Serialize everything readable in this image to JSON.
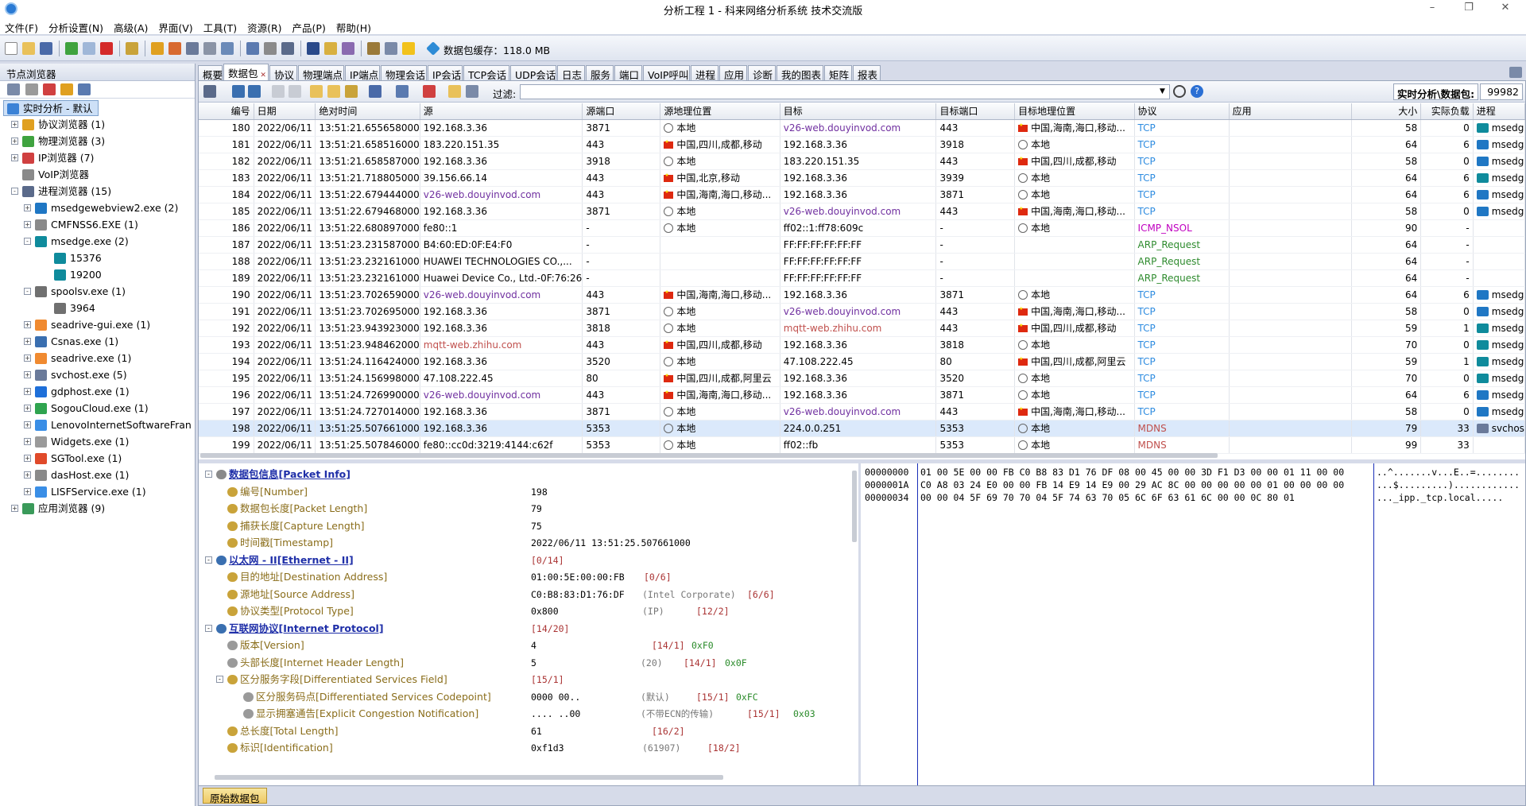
{
  "window": {
    "title": "分析工程 1 - 科来网络分析系统 技术交流版"
  },
  "menu": [
    "文件(F)",
    "分析设置(N)",
    "高级(A)",
    "界面(V)",
    "工具(T)",
    "资源(R)",
    "产品(P)",
    "帮助(H)"
  ],
  "toolbar": {
    "cache_label": "数据包缓存：118.0 MB"
  },
  "left_panel": {
    "title": "节点浏览器",
    "tree": [
      {
        "label": "实时分析 - 默认",
        "level": 0,
        "exp": "",
        "icon": "analysis-icon",
        "color": "#3b82d6",
        "selected": true
      },
      {
        "label": "协议浏览器 (1)",
        "level": 1,
        "exp": "+",
        "icon": "protocol-icon",
        "color": "#e0a020"
      },
      {
        "label": "物理浏览器 (3)",
        "level": 1,
        "exp": "+",
        "icon": "physical-icon",
        "color": "#3fa33f"
      },
      {
        "label": "IP浏览器 (7)",
        "level": 1,
        "exp": "+",
        "icon": "ip-icon",
        "color": "#d04040"
      },
      {
        "label": "VoIP浏览器",
        "level": 1,
        "exp": "",
        "icon": "voip-icon",
        "color": "#8a8a8a"
      },
      {
        "label": "进程浏览器 (15)",
        "level": 1,
        "exp": "-",
        "icon": "process-icon",
        "color": "#5a6a8a"
      },
      {
        "label": "msedgewebview2.exe (2)",
        "level": 2,
        "exp": "+",
        "icon": "webview-icon",
        "color": "#1f77c4"
      },
      {
        "label": "CMFNSS6.EXE (1)",
        "level": 2,
        "exp": "+",
        "icon": "app-icon",
        "color": "#8a8a8a"
      },
      {
        "label": "msedge.exe (2)",
        "level": 2,
        "exp": "-",
        "icon": "edge-icon",
        "color": "#0f8b9c"
      },
      {
        "label": "15376",
        "level": 3,
        "exp": "",
        "icon": "edge-icon",
        "color": "#0f8b9c"
      },
      {
        "label": "19200",
        "level": 3,
        "exp": "",
        "icon": "edge-icon",
        "color": "#0f8b9c"
      },
      {
        "label": "spoolsv.exe (1)",
        "level": 2,
        "exp": "-",
        "icon": "printer-icon",
        "color": "#707070"
      },
      {
        "label": "3964",
        "level": 3,
        "exp": "",
        "icon": "printer-icon",
        "color": "#707070"
      },
      {
        "label": "seadrive-gui.exe (1)",
        "level": 2,
        "exp": "+",
        "icon": "seadrive-icon",
        "color": "#f08a30"
      },
      {
        "label": "Csnas.exe (1)",
        "level": 2,
        "exp": "+",
        "icon": "csnas-icon",
        "color": "#3a6fb0"
      },
      {
        "label": "seadrive.exe (1)",
        "level": 2,
        "exp": "+",
        "icon": "seadrive-icon",
        "color": "#f08a30"
      },
      {
        "label": "svchost.exe (5)",
        "level": 2,
        "exp": "+",
        "icon": "svchost-icon",
        "color": "#6a7a9a"
      },
      {
        "label": "gdphost.exe (1)",
        "level": 2,
        "exp": "+",
        "icon": "gdp-icon",
        "color": "#1e6fd9"
      },
      {
        "label": "SogouCloud.exe (1)",
        "level": 2,
        "exp": "+",
        "icon": "sogou-icon",
        "color": "#2fa44f"
      },
      {
        "label": "LenovoInternetSoftwareFran",
        "level": 2,
        "exp": "+",
        "icon": "lenovo-icon",
        "color": "#3a8ee6"
      },
      {
        "label": "Widgets.exe (1)",
        "level": 2,
        "exp": "+",
        "icon": "widgets-icon",
        "color": "#9a9a9a"
      },
      {
        "label": "SGTool.exe (1)",
        "level": 2,
        "exp": "+",
        "icon": "sgtool-icon",
        "color": "#e04a2a"
      },
      {
        "label": "dasHost.exe (1)",
        "level": 2,
        "exp": "+",
        "icon": "app-icon",
        "color": "#8a8a8a"
      },
      {
        "label": "LISFService.exe (1)",
        "level": 2,
        "exp": "+",
        "icon": "lisf-icon",
        "color": "#3a8ee6"
      },
      {
        "label": "应用浏览器 (9)",
        "level": 1,
        "exp": "+",
        "icon": "application-icon",
        "color": "#3a9a5a"
      }
    ]
  },
  "tabs": [
    "概要",
    "数据包",
    "协议",
    "物理端点",
    "IP端点",
    "物理会话",
    "IP会话",
    "TCP会话",
    "UDP会话",
    "日志",
    "服务",
    "端口",
    "VoIP呼叫",
    "进程",
    "应用",
    "诊断",
    "我的图表",
    "矩阵",
    "报表"
  ],
  "active_tab": 1,
  "filter": {
    "label": "过滤:",
    "value": ""
  },
  "realtime": {
    "label": "实时分析\\数据包:",
    "value": "99982"
  },
  "columns": [
    "编号",
    "日期",
    "绝对时间",
    "源",
    "源端口",
    "源地理位置",
    "目标",
    "目标端口",
    "目标地理位置",
    "协议",
    "应用",
    "大小",
    "实际负载",
    "进程"
  ],
  "packets": [
    {
      "no": "180",
      "date": "2022/06/11",
      "time": "13:51:21.655658000",
      "src": "192.168.3.36",
      "sport": "3871",
      "sgeo": "本地",
      "sflag": "globe",
      "dst": "v26-web.douyinvod.com",
      "dport": "443",
      "dgeo": "中国,海南,海口,移动...",
      "dflag": "cn",
      "proto": "TCP",
      "app": "",
      "size": "58",
      "payload": "0",
      "proc": "msedg",
      "pic": "#0f8b9c"
    },
    {
      "no": "181",
      "date": "2022/06/11",
      "time": "13:51:21.658516000",
      "src": "183.220.151.35",
      "sport": "443",
      "sgeo": "中国,四川,成都,移动",
      "sflag": "cn",
      "dst": "192.168.3.36",
      "dport": "3918",
      "dgeo": "本地",
      "dflag": "globe",
      "proto": "TCP",
      "app": "",
      "size": "64",
      "payload": "6",
      "proc": "msedg",
      "pic": "#1f77c4"
    },
    {
      "no": "182",
      "date": "2022/06/11",
      "time": "13:51:21.658587000",
      "src": "192.168.3.36",
      "sport": "3918",
      "sgeo": "本地",
      "sflag": "globe",
      "dst": "183.220.151.35",
      "dport": "443",
      "dgeo": "中国,四川,成都,移动",
      "dflag": "cn",
      "proto": "TCP",
      "app": "",
      "size": "58",
      "payload": "0",
      "proc": "msedg",
      "pic": "#1f77c4"
    },
    {
      "no": "183",
      "date": "2022/06/11",
      "time": "13:51:21.718805000",
      "src": "39.156.66.14",
      "sport": "443",
      "sgeo": "中国,北京,移动",
      "sflag": "cn",
      "dst": "192.168.3.36",
      "dport": "3939",
      "dgeo": "本地",
      "dflag": "globe",
      "proto": "TCP",
      "app": "",
      "size": "64",
      "payload": "6",
      "proc": "msedg",
      "pic": "#0f8b9c"
    },
    {
      "no": "184",
      "date": "2022/06/11",
      "time": "13:51:22.679444000",
      "src": "v26-web.douyinvod.com",
      "sport": "443",
      "sgeo": "中国,海南,海口,移动...",
      "sflag": "cn",
      "dst": "192.168.3.36",
      "dport": "3871",
      "dgeo": "本地",
      "dflag": "globe",
      "proto": "TCP",
      "app": "",
      "size": "64",
      "payload": "6",
      "proc": "msedg",
      "pic": "#1f77c4"
    },
    {
      "no": "185",
      "date": "2022/06/11",
      "time": "13:51:22.679468000",
      "src": "192.168.3.36",
      "sport": "3871",
      "sgeo": "本地",
      "sflag": "globe",
      "dst": "v26-web.douyinvod.com",
      "dport": "443",
      "dgeo": "中国,海南,海口,移动...",
      "dflag": "cn",
      "proto": "TCP",
      "app": "",
      "size": "58",
      "payload": "0",
      "proc": "msedg",
      "pic": "#1f77c4"
    },
    {
      "no": "186",
      "date": "2022/06/11",
      "time": "13:51:22.680897000",
      "src": "fe80::1",
      "sport": "-",
      "sgeo": "本地",
      "sflag": "globe",
      "dst": "ff02::1:ff78:609c",
      "dport": "-",
      "dgeo": "本地",
      "dflag": "globe",
      "proto": "ICMP_NSOL",
      "app": "",
      "size": "90",
      "payload": "-",
      "proc": "",
      "pic": ""
    },
    {
      "no": "187",
      "date": "2022/06/11",
      "time": "13:51:23.231587000",
      "src": "B4:60:ED:0F:E4:F0",
      "sport": "-",
      "sgeo": "",
      "sflag": "",
      "dst": "FF:FF:FF:FF:FF:FF",
      "dport": "-",
      "dgeo": "",
      "dflag": "",
      "proto": "ARP_Request",
      "app": "",
      "size": "64",
      "payload": "-",
      "proc": "",
      "pic": ""
    },
    {
      "no": "188",
      "date": "2022/06/11",
      "time": "13:51:23.232161000",
      "src": "HUAWEI TECHNOLOGIES CO.,...",
      "sport": "-",
      "sgeo": "",
      "sflag": "",
      "dst": "FF:FF:FF:FF:FF:FF",
      "dport": "-",
      "dgeo": "",
      "dflag": "",
      "proto": "ARP_Request",
      "app": "",
      "size": "64",
      "payload": "-",
      "proc": "",
      "pic": ""
    },
    {
      "no": "189",
      "date": "2022/06/11",
      "time": "13:51:23.232161000",
      "src": "Huawei Device Co., Ltd.-0F:76:26",
      "sport": "-",
      "sgeo": "",
      "sflag": "",
      "dst": "FF:FF:FF:FF:FF:FF",
      "dport": "-",
      "dgeo": "",
      "dflag": "",
      "proto": "ARP_Request",
      "app": "",
      "size": "64",
      "payload": "-",
      "proc": "",
      "pic": ""
    },
    {
      "no": "190",
      "date": "2022/06/11",
      "time": "13:51:23.702659000",
      "src": "v26-web.douyinvod.com",
      "sport": "443",
      "sgeo": "中国,海南,海口,移动...",
      "sflag": "cn",
      "dst": "192.168.3.36",
      "dport": "3871",
      "dgeo": "本地",
      "dflag": "globe",
      "proto": "TCP",
      "app": "",
      "size": "64",
      "payload": "6",
      "proc": "msedg",
      "pic": "#1f77c4"
    },
    {
      "no": "191",
      "date": "2022/06/11",
      "time": "13:51:23.702695000",
      "src": "192.168.3.36",
      "sport": "3871",
      "sgeo": "本地",
      "sflag": "globe",
      "dst": "v26-web.douyinvod.com",
      "dport": "443",
      "dgeo": "中国,海南,海口,移动...",
      "dflag": "cn",
      "proto": "TCP",
      "app": "",
      "size": "58",
      "payload": "0",
      "proc": "msedg",
      "pic": "#1f77c4"
    },
    {
      "no": "192",
      "date": "2022/06/11",
      "time": "13:51:23.943923000",
      "src": "192.168.3.36",
      "sport": "3818",
      "sgeo": "本地",
      "sflag": "globe",
      "dst": "mqtt-web.zhihu.com",
      "dport": "443",
      "dgeo": "中国,四川,成都,移动",
      "dflag": "cn",
      "proto": "TCP",
      "app": "",
      "size": "59",
      "payload": "1",
      "proc": "msedg",
      "pic": "#0f8b9c"
    },
    {
      "no": "193",
      "date": "2022/06/11",
      "time": "13:51:23.948462000",
      "src": "mqtt-web.zhihu.com",
      "sport": "443",
      "sgeo": "中国,四川,成都,移动",
      "sflag": "cn",
      "dst": "192.168.3.36",
      "dport": "3818",
      "dgeo": "本地",
      "dflag": "globe",
      "proto": "TCP",
      "app": "",
      "size": "70",
      "payload": "0",
      "proc": "msedg",
      "pic": "#0f8b9c"
    },
    {
      "no": "194",
      "date": "2022/06/11",
      "time": "13:51:24.116424000",
      "src": "192.168.3.36",
      "sport": "3520",
      "sgeo": "本地",
      "sflag": "globe",
      "dst": "47.108.222.45",
      "dport": "80",
      "dgeo": "中国,四川,成都,阿里云",
      "dflag": "cn",
      "proto": "TCP",
      "app": "",
      "size": "59",
      "payload": "1",
      "proc": "msedg",
      "pic": "#0f8b9c"
    },
    {
      "no": "195",
      "date": "2022/06/11",
      "time": "13:51:24.156998000",
      "src": "47.108.222.45",
      "sport": "80",
      "sgeo": "中国,四川,成都,阿里云",
      "sflag": "cn",
      "dst": "192.168.3.36",
      "dport": "3520",
      "dgeo": "本地",
      "dflag": "globe",
      "proto": "TCP",
      "app": "",
      "size": "70",
      "payload": "0",
      "proc": "msedg",
      "pic": "#0f8b9c"
    },
    {
      "no": "196",
      "date": "2022/06/11",
      "time": "13:51:24.726990000",
      "src": "v26-web.douyinvod.com",
      "sport": "443",
      "sgeo": "中国,海南,海口,移动...",
      "sflag": "cn",
      "dst": "192.168.3.36",
      "dport": "3871",
      "dgeo": "本地",
      "dflag": "globe",
      "proto": "TCP",
      "app": "",
      "size": "64",
      "payload": "6",
      "proc": "msedg",
      "pic": "#1f77c4"
    },
    {
      "no": "197",
      "date": "2022/06/11",
      "time": "13:51:24.727014000",
      "src": "192.168.3.36",
      "sport": "3871",
      "sgeo": "本地",
      "sflag": "globe",
      "dst": "v26-web.douyinvod.com",
      "dport": "443",
      "dgeo": "中国,海南,海口,移动...",
      "dflag": "cn",
      "proto": "TCP",
      "app": "",
      "size": "58",
      "payload": "0",
      "proc": "msedg",
      "pic": "#1f77c4"
    },
    {
      "no": "198",
      "date": "2022/06/11",
      "time": "13:51:25.507661000",
      "src": "192.168.3.36",
      "sport": "5353",
      "sgeo": "本地",
      "sflag": "globe",
      "dst": "224.0.0.251",
      "dport": "5353",
      "dgeo": "本地",
      "dflag": "globe",
      "proto": "MDNS",
      "app": "",
      "size": "79",
      "payload": "33",
      "proc": "svchos",
      "pic": "#6a7a9a",
      "selected": true
    },
    {
      "no": "199",
      "date": "2022/06/11",
      "time": "13:51:25.507846000",
      "src": "fe80::cc0d:3219:4144:c62f",
      "sport": "5353",
      "sgeo": "本地",
      "sflag": "globe",
      "dst": "ff02::fb",
      "dport": "5353",
      "dgeo": "本地",
      "dflag": "globe",
      "proto": "MDNS",
      "app": "",
      "size": "99",
      "payload": "33",
      "proc": "",
      "pic": ""
    }
  ],
  "detail": [
    {
      "lvl": 0,
      "exp": "-",
      "label": "数据包信息[Packet Info]",
      "head": true,
      "ic": "#8a8a8a"
    },
    {
      "lvl": 1,
      "label": "编号[Number]",
      "value": "198",
      "ic": "#c9a33a"
    },
    {
      "lvl": 1,
      "label": "数据包长度[Packet Length]",
      "value": "79",
      "ic": "#c9a33a"
    },
    {
      "lvl": 1,
      "label": "捕获长度[Capture Length]",
      "value": "75",
      "ic": "#c9a33a"
    },
    {
      "lvl": 1,
      "label": "时间戳[Timestamp]",
      "value": "2022/06/11 13:51:25.507661000",
      "ic": "#c9a33a"
    },
    {
      "lvl": 0,
      "exp": "-",
      "label": "以太网 - II[Ethernet - II]",
      "head": true,
      "ic": "#3a6fb0",
      "brk": "[0/14]"
    },
    {
      "lvl": 1,
      "label": "目的地址[Destination Address]",
      "value": "01:00:5E:00:00:FB",
      "brk": "[0/6]",
      "ic": "#c9a33a"
    },
    {
      "lvl": 1,
      "label": "源地址[Source Address]",
      "value": "C0:B8:83:D1:76:DF",
      "extra": "(Intel Corporate)",
      "brk": "[6/6]",
      "ic": "#c9a33a"
    },
    {
      "lvl": 1,
      "label": "协议类型[Protocol Type]",
      "value": "0x800",
      "extra": "(IP)",
      "brk": "[12/2]",
      "ic": "#c9a33a"
    },
    {
      "lvl": 0,
      "exp": "-",
      "label": "互联网协议[Internet Protocol]",
      "head": true,
      "ic": "#3a6fb0",
      "brk": "[14/20]"
    },
    {
      "lvl": 1,
      "label": "版本[Version]",
      "value": "4",
      "brk": "[14/1]",
      "hex": "0xF0",
      "ic": "#9a9a9a"
    },
    {
      "lvl": 1,
      "label": "头部长度[Internet Header Length]",
      "value": "5",
      "extra": "(20)",
      "brk": "[14/1]",
      "hex": "0x0F",
      "ic": "#9a9a9a"
    },
    {
      "lvl": 1,
      "exp": "-",
      "label": "区分服务字段[Differentiated Services Field]",
      "brk": "[15/1]",
      "ic": "#c9a33a"
    },
    {
      "lvl": 2,
      "label": "区分服务码点[Differentiated Services Codepoint]",
      "value": "0000 00..",
      "extra": "(默认)",
      "brk": "[15/1]",
      "hex": "0xFC",
      "ic": "#9a9a9a"
    },
    {
      "lvl": 2,
      "label": "显示拥塞通告[Explicit Congestion Notification]",
      "value": ".... ..00",
      "extra": "(不带ECN的传输)",
      "brk": "[15/1]",
      "hex": "0x03",
      "ic": "#9a9a9a"
    },
    {
      "lvl": 1,
      "label": "总长度[Total Length]",
      "value": "61",
      "brk": "[16/2]",
      "ic": "#c9a33a"
    },
    {
      "lvl": 1,
      "label": "标识[Identification]",
      "value": "0xf1d3",
      "extra": "(61907)",
      "brk": "[18/2]",
      "ic": "#c9a33a"
    }
  ],
  "hex": [
    {
      "off": "00000000",
      "bytes": "01 00 5E 00 00 FB C0 B8 83 D1 76 DF 08 00 45 00 00 3D F1 D3 00 00 01 11 00 00",
      "ascii": "..^.......v...E..=........"
    },
    {
      "off": "0000001A",
      "bytes": "C0 A8 03 24 E0 00 00 FB 14 E9 14 E9 00 29 AC 8C 00 00 00 00 00 01 00 00 00 00",
      "ascii": "...$.........)............"
    },
    {
      "off": "00000034",
      "bytes": "00 00 04 5F 69 70 70 04 5F 74 63 70 05 6C 6F 63 61 6C 00 00 0C 80 01",
      "ascii": "..._ipp._tcp.local....."
    }
  ],
  "bottom_tab": "原始数据包"
}
